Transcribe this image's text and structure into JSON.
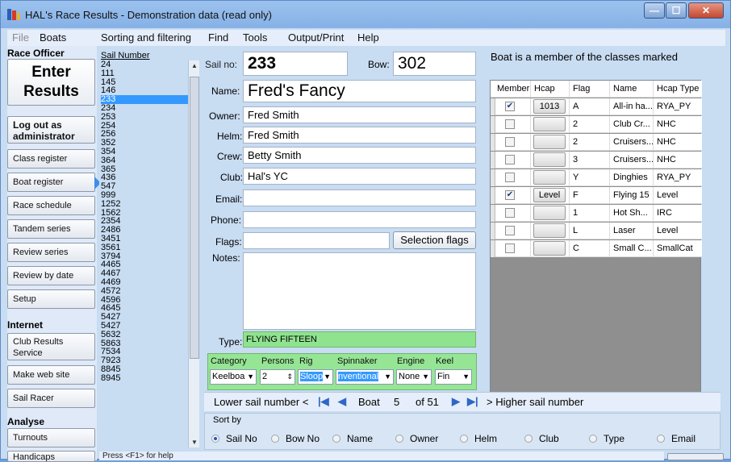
{
  "window": {
    "title": "HAL's Race Results - Demonstration data (read only)",
    "min": "—",
    "max": "☐",
    "close": "✕"
  },
  "menu": [
    "File",
    "Boats",
    "Sorting and filtering",
    "Find",
    "Tools",
    "Output/Print",
    "Help"
  ],
  "left": {
    "race_officer": "Race Officer",
    "enter1": "Enter",
    "enter2": "Results",
    "logout1": "Log out as",
    "logout2": "administrator",
    "class_register": "Class register",
    "boat_register": "Boat register",
    "race_schedule": "Race schedule",
    "tandem_series": "Tandem series",
    "review_series": "Review series",
    "review_by_date": "Review by date",
    "setup": "Setup",
    "internet": "Internet",
    "club_results1": "Club Results",
    "club_results2": "Service",
    "make_web_site": "Make web site",
    "sail_racer": "Sail Racer",
    "analyse": "Analyse",
    "turnouts": "Turnouts",
    "handicaps": "Handicaps"
  },
  "sail_list": {
    "header": "Sail Number",
    "items": [
      "24",
      "111",
      "145",
      "146",
      "233",
      "234",
      "253",
      "254",
      "256",
      "352",
      "354",
      "364",
      "365",
      "436",
      "547",
      "999",
      "1252",
      "1562",
      "2354",
      "2486",
      "3451",
      "3561",
      "3794",
      "4465",
      "4467",
      "4469",
      "4572",
      "4596",
      "4645",
      "5427",
      "5427",
      "5632",
      "5863",
      "7534",
      "7923",
      "8845",
      "8945"
    ],
    "selected_index": 4
  },
  "form": {
    "sail_no_label": "Sail no:",
    "sail_no": "233",
    "bow_label": "Bow:",
    "bow": "302",
    "name_label": "Name:",
    "name": "Fred's Fancy",
    "owner_label": "Owner:",
    "owner": "Fred Smith",
    "helm_label": "Helm:",
    "helm": "Fred Smith",
    "crew_label": "Crew:",
    "crew": "Betty Smith",
    "club_label": "Club:",
    "club": "Hal's YC",
    "email_label": "Email:",
    "email": "",
    "phone_label": "Phone:",
    "phone": "",
    "flags_label": "Flags:",
    "flags": "",
    "selection_flags": "Selection flags",
    "notes_label": "Notes:",
    "notes": "",
    "type_label": "Type:",
    "type": "FLYING FIFTEEN"
  },
  "options": {
    "category_label": "Category",
    "category": "Keelboa",
    "persons_label": "Persons",
    "persons": "2",
    "rig_label": "Rig",
    "rig": "Sloop",
    "spinnaker_label": "Spinnaker",
    "spinnaker": "nventional",
    "engine_label": "Engine",
    "engine": "None",
    "keel_label": "Keel",
    "keel": "Fin"
  },
  "classes": {
    "title": "Boat is a member of the classes marked",
    "headers": [
      "Member",
      "Hcap",
      "Flag",
      "Name",
      "Hcap Type"
    ],
    "rows": [
      {
        "member": "✔",
        "hcap": "1013",
        "flag": "A",
        "name": "All-in ha...",
        "hcap_type": "RYA_PY"
      },
      {
        "member": "",
        "hcap": "",
        "flag": "2",
        "name": "Club Cr...",
        "hcap_type": "NHC"
      },
      {
        "member": "",
        "hcap": "",
        "flag": "2",
        "name": "Cruisers...",
        "hcap_type": "NHC"
      },
      {
        "member": "",
        "hcap": "",
        "flag": "3",
        "name": "Cruisers...",
        "hcap_type": "NHC"
      },
      {
        "member": "",
        "hcap": "",
        "flag": "Y",
        "name": "Dinghies",
        "hcap_type": "RYA_PY"
      },
      {
        "member": "✔",
        "hcap": "Level",
        "flag": "F",
        "name": "Flying 15",
        "hcap_type": "Level"
      },
      {
        "member": "",
        "hcap": "",
        "flag": "1",
        "name": "Hot Sh...",
        "hcap_type": "IRC"
      },
      {
        "member": "",
        "hcap": "",
        "flag": "L",
        "name": "Laser",
        "hcap_type": "Level"
      },
      {
        "member": "",
        "hcap": "",
        "flag": "C",
        "name": "Small C...",
        "hcap_type": "SmallCat"
      }
    ]
  },
  "nav": {
    "lower": "Lower sail number <",
    "boat_label": "Boat",
    "boat_num": "5",
    "of_total": "of 51",
    "higher": "> Higher sail number"
  },
  "sortby": {
    "label": "Sort by",
    "options": [
      "Sail No",
      "Bow No",
      "Name",
      "Owner",
      "Helm",
      "Club",
      "Type",
      "Email"
    ],
    "selected_index": 0
  },
  "status": {
    "help": "Press <F1> for help"
  },
  "colors": {
    "selection": "#3399ff",
    "type_bg": "#8fe38f",
    "window_bg": "#c8dcf2"
  }
}
